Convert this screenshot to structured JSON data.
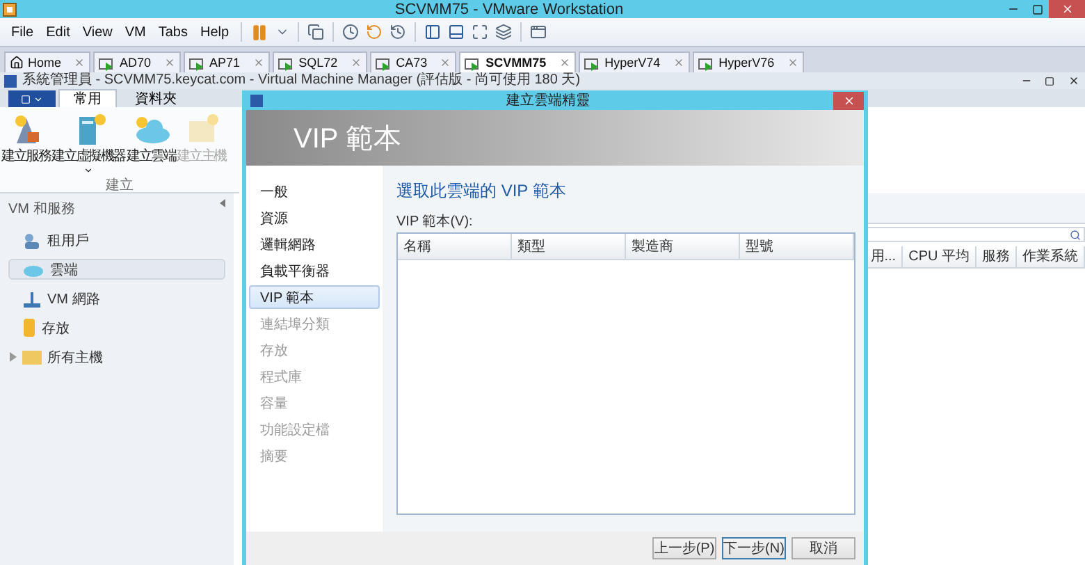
{
  "window": {
    "title": "SCVMM75 - VMware Workstation"
  },
  "menu": [
    "File",
    "Edit",
    "View",
    "VM",
    "Tabs",
    "Help"
  ],
  "vm_tabs": [
    {
      "label": "Home",
      "kind": "home",
      "selected": false
    },
    {
      "label": "AD70",
      "kind": "vm",
      "selected": false
    },
    {
      "label": "AP71",
      "kind": "vm",
      "selected": false
    },
    {
      "label": "SQL72",
      "kind": "vm",
      "selected": false
    },
    {
      "label": "CA73",
      "kind": "vm",
      "selected": false
    },
    {
      "label": "SCVMM75",
      "kind": "vm",
      "selected": true
    },
    {
      "label": "HyperV74",
      "kind": "vm",
      "selected": false
    },
    {
      "label": "HyperV76",
      "kind": "vm",
      "selected": false
    }
  ],
  "app": {
    "title": "系統管理員 - SCVMM75.keycat.com - Virtual Machine Manager (評估版 - 尚可使用 180 天)",
    "ribbon_tabs": [
      {
        "label": "常用",
        "selected": true
      },
      {
        "label": "資料夾",
        "selected": false
      }
    ],
    "ribbon_buttons": [
      {
        "label": "建立服務",
        "kind": "service",
        "disabled": false,
        "dropdown": false
      },
      {
        "label": "建立虛擬機器",
        "kind": "server",
        "disabled": false,
        "dropdown": true
      },
      {
        "label": "建立雲端",
        "kind": "cloud",
        "disabled": false,
        "dropdown": false
      },
      {
        "label": "建立主機",
        "kind": "folder",
        "disabled": true,
        "dropdown": false
      }
    ],
    "ribbon_group": "建立",
    "nav_header": "VM 和服務",
    "nav_items": [
      {
        "label": "租用戶",
        "kind": "tenant",
        "selected": false,
        "expandable": false
      },
      {
        "label": "雲端",
        "kind": "cloud",
        "selected": true,
        "expandable": false
      },
      {
        "label": "VM 網路",
        "kind": "network",
        "selected": false,
        "expandable": false
      },
      {
        "label": "存放",
        "kind": "storage",
        "selected": false,
        "expandable": false
      },
      {
        "label": "所有主機",
        "kind": "folder",
        "selected": false,
        "expandable": true
      }
    ],
    "columns": [
      "用...",
      "CPU 平均",
      "服務",
      "作業系統"
    ]
  },
  "dialog": {
    "title": "建立雲端精靈",
    "header": "VIP 範本",
    "steps": [
      {
        "label": "一般",
        "selected": false,
        "disabled": false
      },
      {
        "label": "資源",
        "selected": false,
        "disabled": false
      },
      {
        "label": "邏輯網路",
        "selected": false,
        "disabled": false
      },
      {
        "label": "負載平衡器",
        "selected": false,
        "disabled": false
      },
      {
        "label": "VIP 範本",
        "selected": true,
        "disabled": false
      },
      {
        "label": "連結埠分類",
        "selected": false,
        "disabled": true
      },
      {
        "label": "存放",
        "selected": false,
        "disabled": true
      },
      {
        "label": "程式庫",
        "selected": false,
        "disabled": true
      },
      {
        "label": "容量",
        "selected": false,
        "disabled": true
      },
      {
        "label": "功能設定檔",
        "selected": false,
        "disabled": true
      },
      {
        "label": "摘要",
        "selected": false,
        "disabled": true
      }
    ],
    "heading": "選取此雲端的 VIP 範本",
    "list_label": "VIP 範本(V):",
    "columns": [
      "名稱",
      "類型",
      "製造商",
      "型號"
    ],
    "buttons": [
      {
        "label": "上一步(P)",
        "selected": false
      },
      {
        "label": "下一步(N)",
        "selected": true
      },
      {
        "label": "取消",
        "selected": false
      }
    ]
  }
}
